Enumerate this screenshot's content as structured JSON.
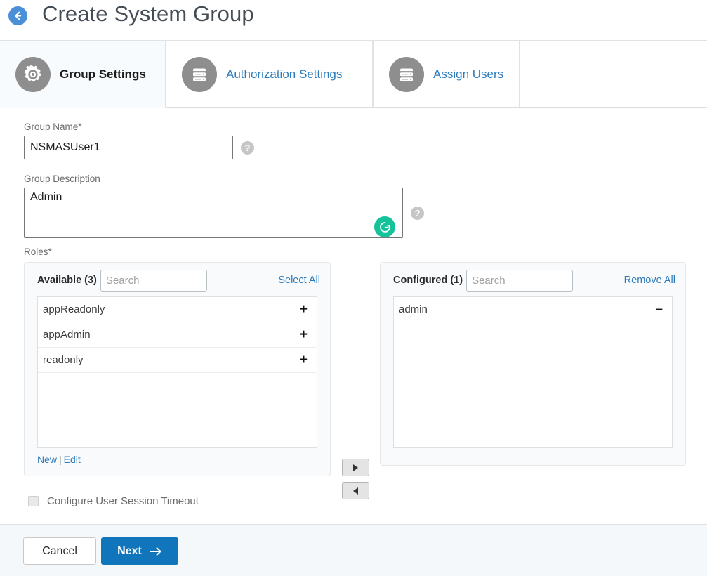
{
  "header": {
    "back_icon": "back-arrow-icon",
    "title": "Create System Group"
  },
  "tabs": [
    {
      "label": "Group Settings",
      "icon": "gear-icon",
      "active": true
    },
    {
      "label": "Authorization Settings",
      "icon": "server-stack-icon",
      "active": false
    },
    {
      "label": "Assign Users",
      "icon": "server-stack-icon",
      "active": false
    }
  ],
  "form": {
    "group_name": {
      "label": "Group Name*",
      "value": "NSMASUser1",
      "placeholder": "",
      "help_icon": "help-icon"
    },
    "group_description": {
      "label": "Group Description",
      "value": "Admin",
      "placeholder": "",
      "help_icon": "help-icon",
      "grammarly_icon": "grammarly-icon"
    },
    "roles": {
      "label": "Roles*",
      "available": {
        "header": "Available (3)",
        "search_placeholder": "Search",
        "search_value": "",
        "action": "Select All",
        "items": [
          {
            "name": "appReadonly",
            "sign": "+"
          },
          {
            "name": "appAdmin",
            "sign": "+"
          },
          {
            "name": "readonly",
            "sign": "+"
          }
        ],
        "footer_new": "New",
        "footer_sep": "|",
        "footer_edit": "Edit"
      },
      "configured": {
        "header": "Configured (1)",
        "search_placeholder": "Search",
        "search_value": "",
        "action": "Remove All",
        "items": [
          {
            "name": "admin",
            "sign": "–"
          }
        ]
      },
      "transfer": {
        "move_right_icon": "arrow-right-icon",
        "move_left_icon": "arrow-left-icon"
      }
    },
    "session_timeout": {
      "label": "Configure User Session Timeout",
      "checked": false
    }
  },
  "footer": {
    "cancel_label": "Cancel",
    "next_label": "Next",
    "next_arrow_icon": "arrow-right-icon"
  },
  "colors": {
    "accent_blue": "#1075ba",
    "link_blue": "#2d7bbd",
    "back_circle": "#4a90d9",
    "tab_icon_gray": "#8e8e8e",
    "grammarly_green": "#15c39a",
    "footer_bg": "#f4f8fb",
    "panel_bg": "#f8fafb"
  }
}
